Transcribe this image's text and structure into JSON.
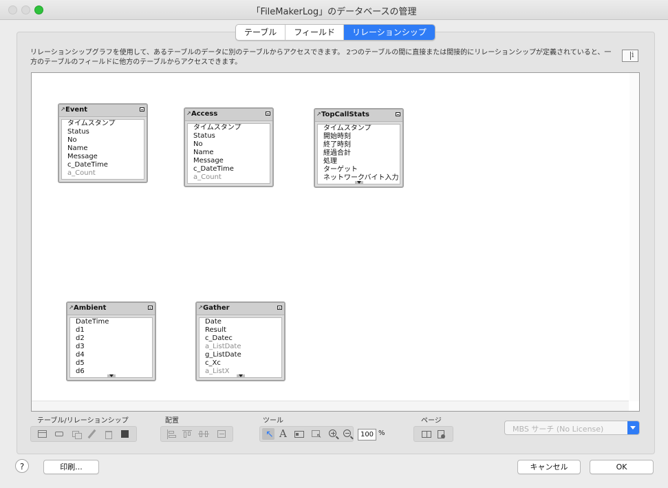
{
  "window": {
    "title": "「FileMakerLog」のデータベースの管理"
  },
  "tabs": [
    {
      "label": "テーブル",
      "active": false
    },
    {
      "label": "フィールド",
      "active": false
    },
    {
      "label": "リレーションシップ",
      "active": true
    }
  ],
  "description": "リレーションシップグラフを使用して、あるテーブルのデータに別のテーブルからアクセスできます。 2つのテーブルの間に直接または間接的にリレーションシップが定義されていると、一方のテーブルのフィールドに他方のテーブルからアクセスできます。",
  "info_button_char": "i",
  "tables": [
    {
      "name": "Event",
      "fields": [
        {
          "name": "タイムスタンプ"
        },
        {
          "name": "Status"
        },
        {
          "name": "No"
        },
        {
          "name": "Name"
        },
        {
          "name": "Message"
        },
        {
          "name": "c_DateTime"
        },
        {
          "name": "a_Count",
          "calc": true
        }
      ]
    },
    {
      "name": "Access",
      "fields": [
        {
          "name": "タイムスタンプ"
        },
        {
          "name": "Status"
        },
        {
          "name": "No"
        },
        {
          "name": "Name"
        },
        {
          "name": "Message"
        },
        {
          "name": "c_DateTime"
        },
        {
          "name": "a_Count",
          "calc": true
        }
      ]
    },
    {
      "name": "TopCallStats",
      "fields": [
        {
          "name": "タイムスタンプ"
        },
        {
          "name": "開始時刻"
        },
        {
          "name": "終了時刻"
        },
        {
          "name": "経過合計"
        },
        {
          "name": "処理"
        },
        {
          "name": "ターゲット"
        },
        {
          "name": "ネットワークバイト入力"
        }
      ]
    },
    {
      "name": "Ambient",
      "fields": [
        {
          "name": "DateTime"
        },
        {
          "name": "d1"
        },
        {
          "name": "d2"
        },
        {
          "name": "d3"
        },
        {
          "name": "d4"
        },
        {
          "name": "d5"
        },
        {
          "name": "d6"
        }
      ]
    },
    {
      "name": "Gather",
      "fields": [
        {
          "name": "Date"
        },
        {
          "name": "Result"
        },
        {
          "name": "c_Datec"
        },
        {
          "name": "a_ListDate",
          "calc": true
        },
        {
          "name": "g_ListDate"
        },
        {
          "name": "c_Xc"
        },
        {
          "name": "a_ListX",
          "calc": true
        }
      ]
    }
  ],
  "toolbar": {
    "section_tables": "テーブル/リレーションシップ",
    "section_arrange": "配置",
    "section_tools": "ツール",
    "section_page": "ページ",
    "zoom": "100",
    "zoom_unit": "%"
  },
  "search": {
    "label": "MBS サーチ (No License)"
  },
  "buttons": {
    "help": "?",
    "print": "印刷...",
    "cancel": "キャンセル",
    "ok": "OK"
  },
  "colors": {
    "accent": "#2f7cf6"
  }
}
